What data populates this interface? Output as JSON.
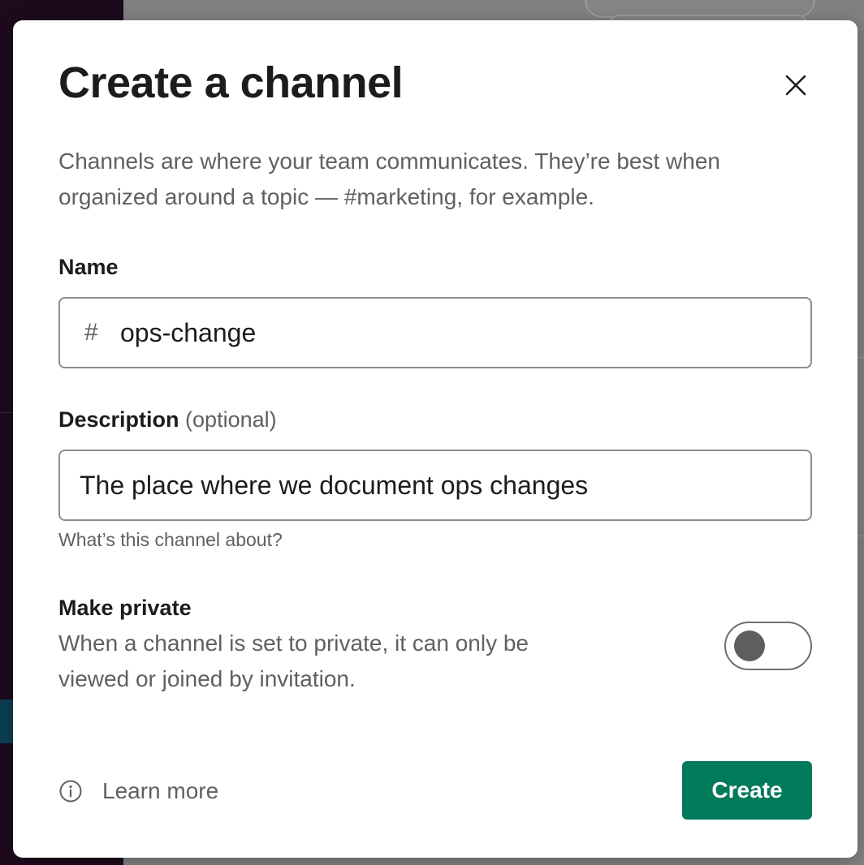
{
  "modal": {
    "title": "Create a channel",
    "intro": "Channels are where your team communicates. They’re best when organized around a topic — #marketing, for example."
  },
  "name_field": {
    "label": "Name",
    "prefix": "#",
    "value": "ops-change"
  },
  "description_field": {
    "label": "Description",
    "optional_note": "(optional)",
    "value": "The place where we document ops changes",
    "hint": "What’s this channel about?"
  },
  "private_setting": {
    "title": "Make private",
    "description": "When a channel is set to private, it can only be viewed or joined by invitation.",
    "enabled": false
  },
  "footer": {
    "learn_more_label": "Learn more",
    "create_label": "Create"
  },
  "icons": {
    "close": "close-icon",
    "info": "info-icon"
  },
  "colors": {
    "primary_button": "#007a5a",
    "text_primary": "#1d1c1d",
    "text_secondary": "#616061"
  }
}
